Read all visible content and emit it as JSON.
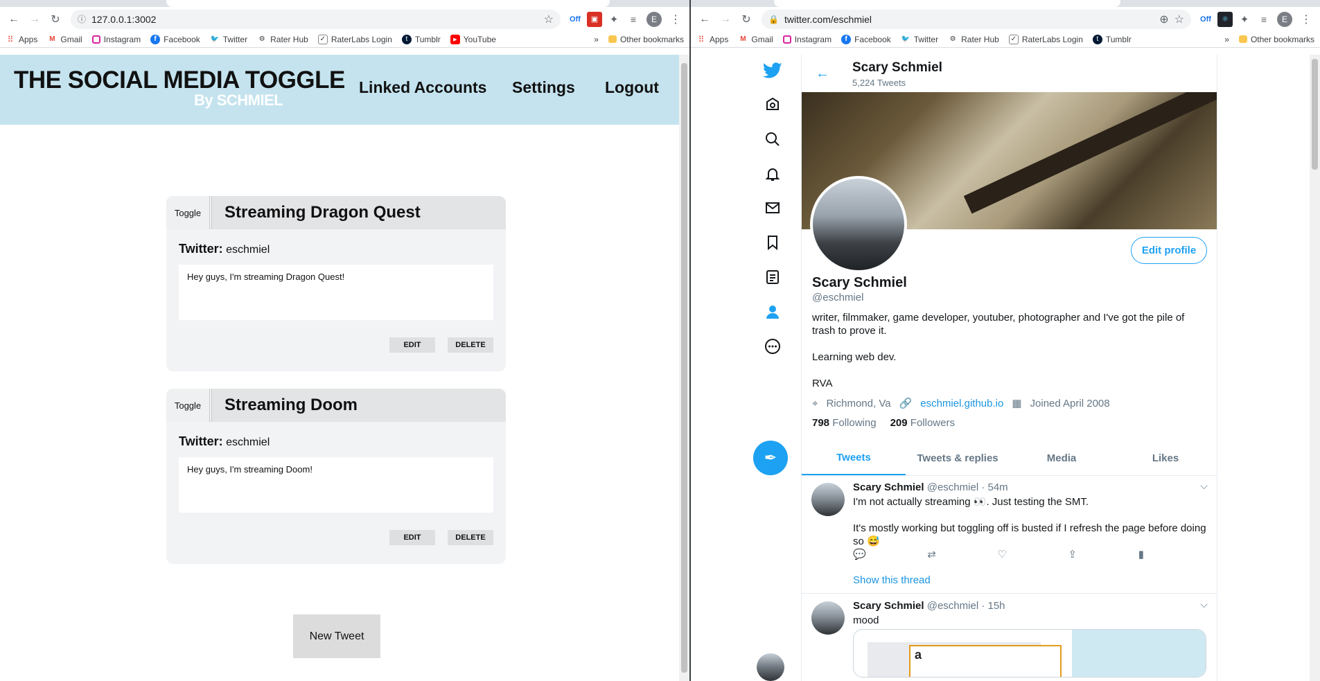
{
  "left_browser": {
    "url": "127.0.0.1:3002",
    "bookmarks": [
      "Apps",
      "Gmail",
      "Instagram",
      "Facebook",
      "Twitter",
      "Rater Hub",
      "RaterLabs Login",
      "Tumblr",
      "YouTube"
    ],
    "more": "»",
    "other_bookmarks": "Other bookmarks",
    "profile_letter": "E",
    "ext_badge": "Off"
  },
  "app": {
    "logo": "THE SOCIAL MEDIA TOGGLE",
    "logo_sub": "By SCHMIEL",
    "nav": {
      "linked": "Linked Accounts",
      "settings": "Settings",
      "logout": "Logout"
    },
    "cards": [
      {
        "toggle": "Toggle",
        "title": "Streaming Dragon Quest",
        "platform": "Twitter:",
        "account": "eschmiel",
        "message": "Hey guys, I'm streaming Dragon Quest!",
        "edit": "EDIT",
        "delete": "DELETE"
      },
      {
        "toggle": "Toggle",
        "title": "Streaming Doom",
        "platform": "Twitter:",
        "account": "eschmiel",
        "message": "Hey guys, I'm streaming Doom!",
        "edit": "EDIT",
        "delete": "DELETE"
      }
    ],
    "new_tweet": "New Tweet"
  },
  "right_browser": {
    "url": "twitter.com/eschmiel",
    "bookmarks": [
      "Apps",
      "Gmail",
      "Instagram",
      "Facebook",
      "Twitter",
      "Rater Hub",
      "RaterLabs Login",
      "Tumblr"
    ],
    "more": "»",
    "other_bookmarks": "Other bookmarks",
    "profile_letter": "E",
    "ext_badge": "Off"
  },
  "twitter": {
    "header_name": "Scary Schmiel",
    "tweet_count": "5,224 Tweets",
    "edit_profile": "Edit profile",
    "name": "Scary Schmiel",
    "handle": "@eschmiel",
    "bio_1": "writer, filmmaker, game developer, youtuber, photographer and I've got the pile of trash to prove it.",
    "bio_2": "Learning web dev.",
    "bio_3": "RVA",
    "location": "Richmond, Va",
    "website": "eschmiel.github.io",
    "joined": "Joined April 2008",
    "following_count": "798",
    "following_label": "Following",
    "followers_count": "209",
    "followers_label": "Followers",
    "tabs": [
      "Tweets",
      "Tweets & replies",
      "Media",
      "Likes"
    ],
    "tweets": [
      {
        "name": "Scary Schmiel",
        "handle": "@eschmiel",
        "time": "· 54m",
        "line1": "I'm not actually streaming 👀. Just testing the SMT.",
        "line2": "It's mostly working but toggling off is busted if I refresh the page before doing so 😅",
        "show_thread": "Show this thread"
      },
      {
        "name": "Scary Schmiel",
        "handle": "@eschmiel",
        "time": "· 15h",
        "line1": "mood",
        "embed_letter": "a"
      }
    ]
  }
}
